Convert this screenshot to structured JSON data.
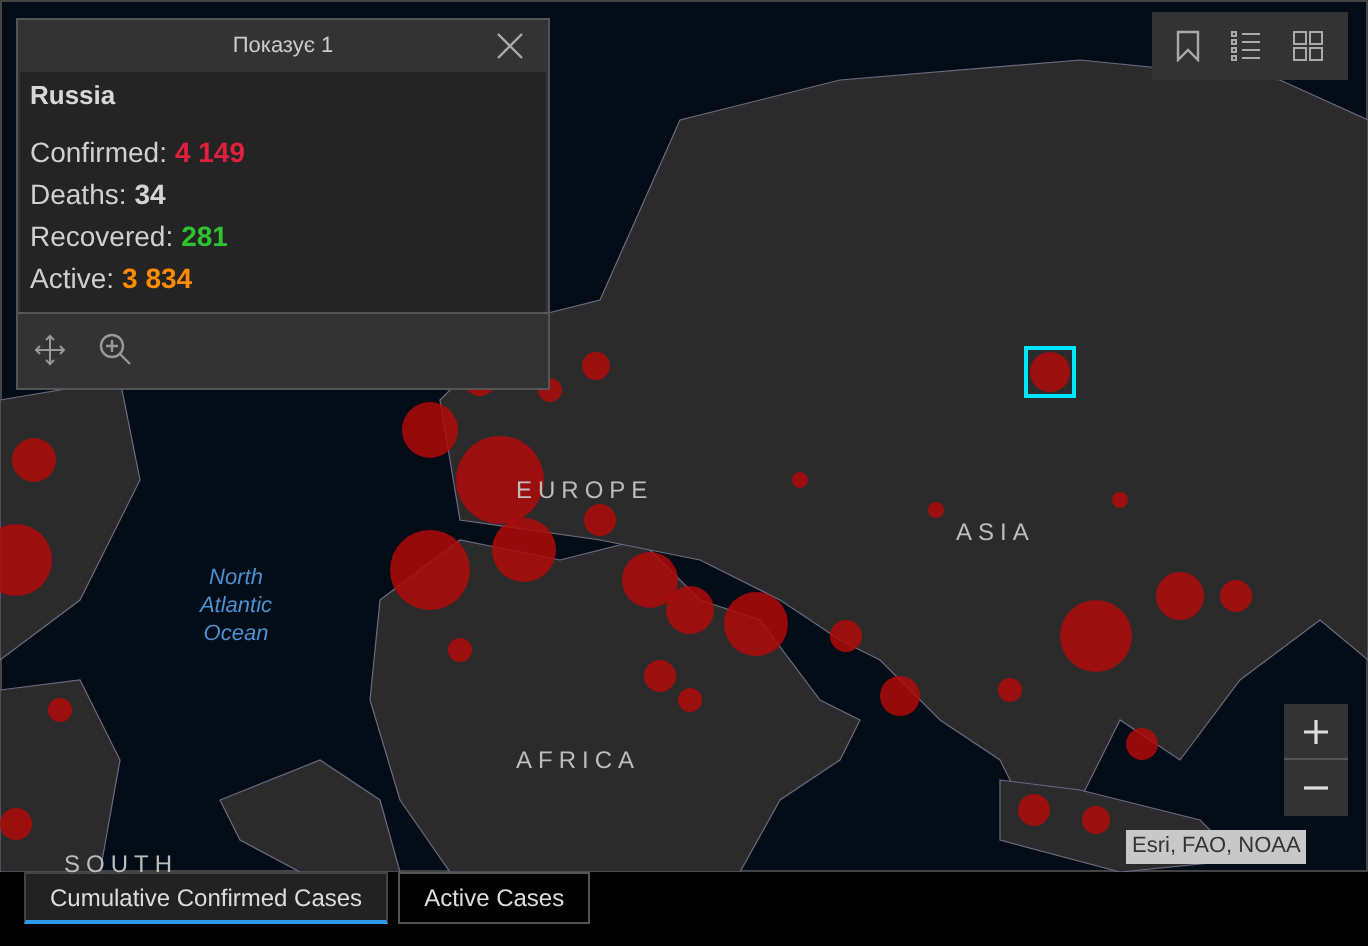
{
  "popup": {
    "title": "Показує 1",
    "country": "Russia",
    "stats": [
      {
        "label": "Confirmed:",
        "value": "4 149",
        "color": "#e0203c"
      },
      {
        "label": "Deaths:",
        "value": "34",
        "color": "#d4d4d4"
      },
      {
        "label": "Recovered:",
        "value": "281",
        "color": "#2fc32f"
      },
      {
        "label": "Active:",
        "value": "3 834",
        "color": "#ff8c00"
      }
    ]
  },
  "map_labels": [
    {
      "text": "EUROPE",
      "kind": "region"
    },
    {
      "text": "ASIA",
      "kind": "region"
    },
    {
      "text": "AFRICA",
      "kind": "region"
    },
    {
      "text": "SOUTH",
      "kind": "region"
    },
    {
      "text": "North Atlantic Ocean",
      "kind": "ocean"
    }
  ],
  "attribution": "Esri, FAO, NOAA",
  "tabs": [
    {
      "label": "Cumulative Confirmed Cases",
      "selected": true
    },
    {
      "label": "Active Cases",
      "selected": false
    }
  ]
}
